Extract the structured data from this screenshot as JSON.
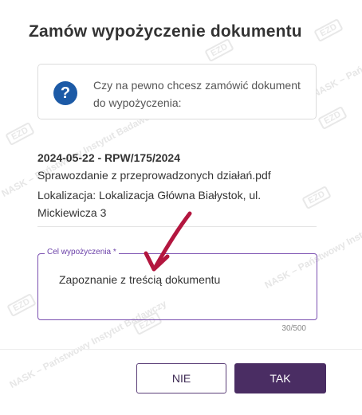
{
  "dialog": {
    "title": "Zamów wypożyczenie dokumentu"
  },
  "confirmation": {
    "icon": "question-icon",
    "icon_glyph": "?",
    "message": "Czy na pewno chcesz zamówić dokument do wypożyczenia:"
  },
  "document": {
    "title": "2024-05-22 - RPW/175/2024",
    "file_name": "Sprawozdanie z przeprowadzonych działań.pdf",
    "location": "Lokalizacja: Lokalizacja Główna Białystok, ul. Mickiewicza 3"
  },
  "purpose_field": {
    "label": "Cel wypożyczenia *",
    "value": "Zapoznanie z treścią dokumentu",
    "counter": "30/500"
  },
  "buttons": {
    "no_label": "NIE",
    "yes_label": "TAK"
  },
  "watermark": {
    "logo": "EZD",
    "text": "NASK – Państwowy Instytut Badawczy"
  },
  "colors": {
    "accent": "#4a2d63",
    "field_border": "#7a4fb0",
    "icon_blue": "#1c5aa6",
    "annotation_arrow": "#b3163f"
  }
}
